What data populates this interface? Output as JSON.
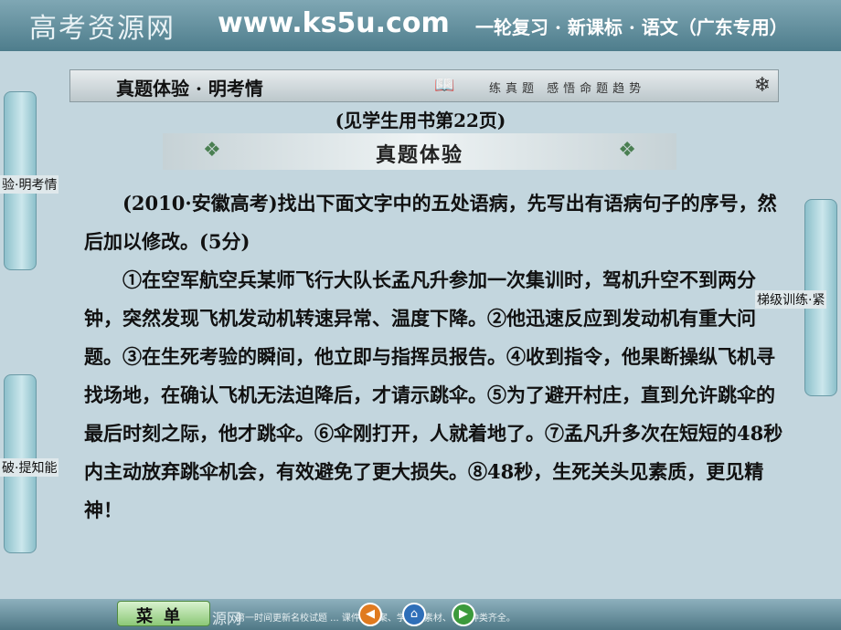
{
  "header": {
    "brand": "高考资源网",
    "url": "www.ks5u.com",
    "series": "一轮复习 · 新课标 · 语文（广东专用）"
  },
  "banner": {
    "title": "真题体验 · 明考情",
    "subtitle": "练真题 感悟命题趋势",
    "snow_glyph": "❄"
  },
  "reference": "(见学生用书第22页)",
  "section_title": "真题体验",
  "side_tabs": {
    "left_top": "验·明考情",
    "left_bottom": "破·提知能",
    "right": "梯级训练·紧"
  },
  "question": {
    "intro": "(2010·安徽高考)找出下面文字中的五处语病，先写出有语病句子的序号，然后加以修改。(5分)",
    "body": "①在空军航空兵某师飞行大队长孟凡升参加一次集训时，驾机升空不到两分钟，突然发现飞机发动机转速异常、温度下降。②他迅速反应到发动机有重大问题。③在生死考验的瞬间，他立即与指挥员报告。④收到指令，他果断操纵飞机寻找场地，在确认飞机无法迫降后，才请示跳伞。⑤为了避开村庄，直到允许跳伞的最后时刻之际，他才跳伞。⑥伞刚打开，人就着地了。⑦孟凡升多次在短短的48秒内主动放弃跳伞机会，有效避免了更大损失。⑧48秒，生死关头见素质，更见精神！"
  },
  "footer": {
    "menu_label": "菜单",
    "logo": "源网",
    "nav_prev": "◀",
    "nav_home": "⌂",
    "nav_next": "▶",
    "info": "第一时间更新名校试题 ... 课件、教案、学案、素材、论文种类齐全。"
  },
  "colors": {
    "accent": "#4e7d8c",
    "tab": "#8dc0cb",
    "menu": "#8cc877",
    "nav_prev": "#e07a1f",
    "nav_home": "#2f6fb8",
    "nav_next": "#3c9a3c"
  }
}
